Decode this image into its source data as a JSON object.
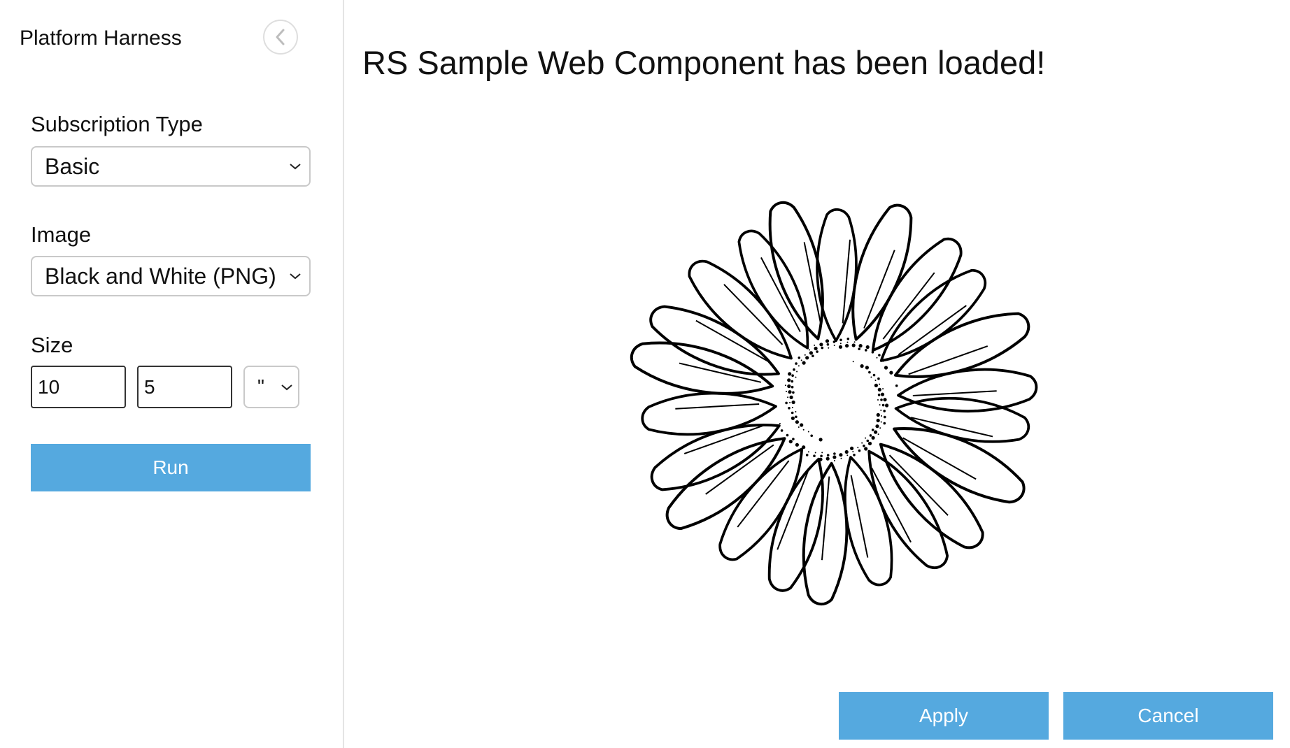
{
  "sidebar": {
    "title": "Platform Harness",
    "collapse_icon": "chevron-left-icon",
    "subscription": {
      "label": "Subscription Type",
      "value": "Basic"
    },
    "image": {
      "label": "Image",
      "value": "Black and White (PNG)"
    },
    "size": {
      "label": "Size",
      "width": "10",
      "height": "5",
      "unit": "\""
    },
    "run_label": "Run"
  },
  "main": {
    "heading": "RS Sample Web Component has been loaded!",
    "image_description_icon": "daisy-line-art-image",
    "apply_label": "Apply",
    "cancel_label": "Cancel"
  },
  "colors": {
    "accent": "#55a9df",
    "divider": "#e4e4e4"
  }
}
